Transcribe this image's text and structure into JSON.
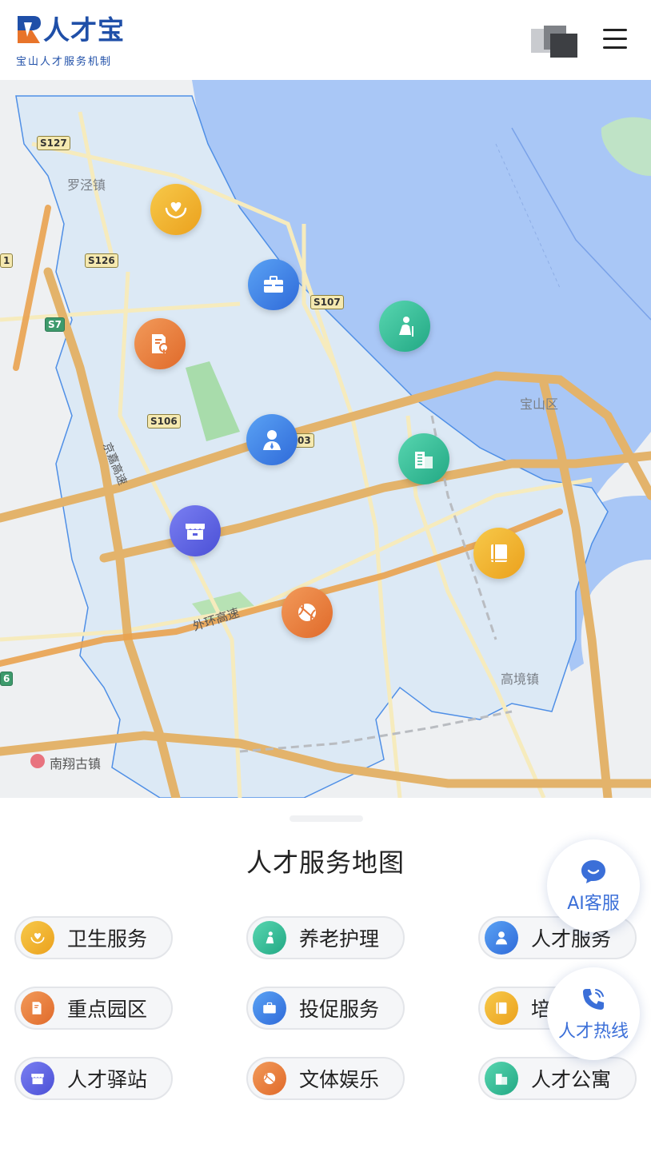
{
  "header": {
    "logo_title": "人才宝",
    "logo_subtitle": "宝山人才服务机制",
    "logo_icon": "logo-icon",
    "cube_icon": "cube-icon",
    "menu_icon": "menu-icon"
  },
  "map": {
    "place_labels": {
      "luojing": "罗泾镇",
      "baoshan": "宝山区",
      "gaojing": "高境镇",
      "nanxiang": "南翔古镇"
    },
    "road_labels": {
      "s127": "S127",
      "s126": "S126",
      "s7": "S7",
      "s107": "S107",
      "s106": "S106",
      "s103_partial": "03",
      "left_edge_6": "6",
      "left_edge_1": "1"
    },
    "road_names": {
      "huaijia": "京嘉高速",
      "waihuan": "外环高速"
    },
    "markers": [
      {
        "name": "health",
        "icon": "heart-hands-icon",
        "color": "yellow"
      },
      {
        "name": "investment",
        "icon": "briefcase-icon",
        "color": "blue"
      },
      {
        "name": "elderly",
        "icon": "elderly-icon",
        "color": "teal"
      },
      {
        "name": "park",
        "icon": "document-tree-icon",
        "color": "orange"
      },
      {
        "name": "talent",
        "icon": "person-icon",
        "color": "blue"
      },
      {
        "name": "apartment",
        "icon": "building-icon",
        "color": "teal"
      },
      {
        "name": "station",
        "icon": "shop-icon",
        "color": "indigo"
      },
      {
        "name": "training",
        "icon": "book-icon",
        "color": "yellow"
      },
      {
        "name": "sports",
        "icon": "ball-icon",
        "color": "orange"
      }
    ],
    "colors": {
      "district_fill": "#dce9f5",
      "water": "#a9c7f6",
      "highway": "#e3b36b",
      "road": "#f3e2a0",
      "boundary": "#4f8fe6"
    }
  },
  "panel": {
    "title": "人才服务地图",
    "categories": [
      {
        "label": "卫生服务",
        "icon": "heart-hands-icon",
        "color": "yellow"
      },
      {
        "label": "养老护理",
        "icon": "elderly-icon",
        "color": "teal"
      },
      {
        "label": "人才服务",
        "icon": "person-icon",
        "color": "blue"
      },
      {
        "label": "重点园区",
        "icon": "document-tree-icon",
        "color": "orange"
      },
      {
        "label": "投促服务",
        "icon": "briefcase-icon",
        "color": "blue"
      },
      {
        "label": "培",
        "icon": "book-icon",
        "color": "yellow"
      },
      {
        "label": "人才驿站",
        "icon": "shop-icon",
        "color": "indigo"
      },
      {
        "label": "文体娱乐",
        "icon": "ball-icon",
        "color": "orange"
      },
      {
        "label": "人才公寓",
        "icon": "building-icon",
        "color": "teal"
      }
    ]
  },
  "floating": {
    "ai_service": "AI客服",
    "hotline": "人才热线",
    "ai_icon": "chat-bubble-icon",
    "hotline_icon": "phone-icon"
  }
}
